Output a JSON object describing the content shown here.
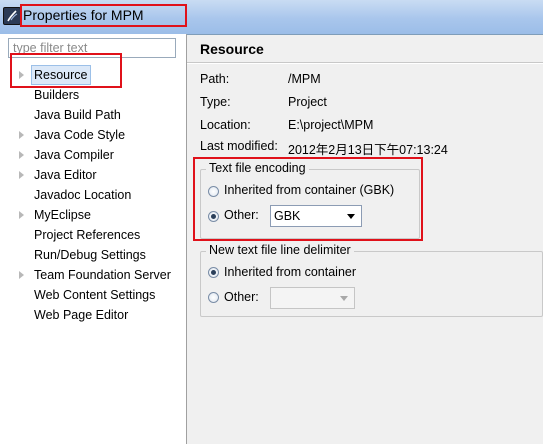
{
  "window": {
    "title": "Properties for MPM"
  },
  "filter": {
    "placeholder": "type filter text"
  },
  "tree": {
    "items": [
      {
        "label": "Resource",
        "expandable": true,
        "selected": true
      },
      {
        "label": "Builders",
        "expandable": false
      },
      {
        "label": "Java Build Path",
        "expandable": false
      },
      {
        "label": "Java Code Style",
        "expandable": true
      },
      {
        "label": "Java Compiler",
        "expandable": true
      },
      {
        "label": "Java Editor",
        "expandable": true
      },
      {
        "label": "Javadoc Location",
        "expandable": false
      },
      {
        "label": "MyEclipse",
        "expandable": true
      },
      {
        "label": "Project References",
        "expandable": false
      },
      {
        "label": "Run/Debug Settings",
        "expandable": false
      },
      {
        "label": "Team Foundation Server",
        "expandable": true
      },
      {
        "label": "Web Content Settings",
        "expandable": false
      },
      {
        "label": "Web Page Editor",
        "expandable": false
      }
    ]
  },
  "page": {
    "title": "Resource",
    "props": {
      "path_label": "Path:",
      "path_value": "/MPM",
      "type_label": "Type:",
      "type_value": "Project",
      "location_label": "Location:",
      "location_value": "E:\\project\\MPM",
      "modified_label": "Last modified:",
      "modified_value": "2012年2月13日下午07:13:24"
    },
    "encoding": {
      "title": "Text file encoding",
      "inherited_label": "Inherited from container (GBK)",
      "other_label": "Other:",
      "other_value": "GBK",
      "selected": "other"
    },
    "delimiter": {
      "title": "New text file line delimiter",
      "inherited_label": "Inherited from container",
      "other_label": "Other:",
      "other_value": "",
      "selected": "inherited"
    }
  },
  "colors": {
    "highlight_box": "#e0111a",
    "title_bar": "#a9c6ec",
    "selection": "#dbe8f8"
  }
}
